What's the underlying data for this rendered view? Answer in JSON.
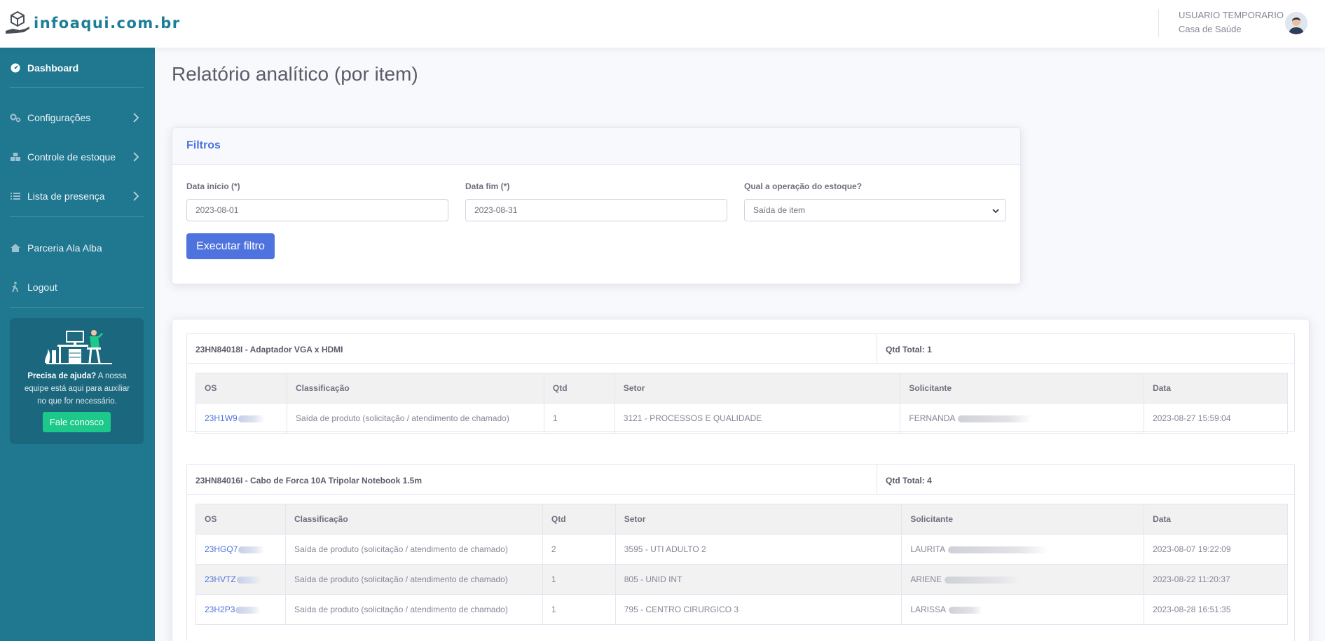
{
  "brand": {
    "name": "infoaqui.com.br"
  },
  "user": {
    "name": "USUARIO TEMPORARIO",
    "organization": "Casa de Saúde"
  },
  "sidebar": {
    "items": [
      {
        "label": "Dashboard",
        "icon": "tachometer-icon",
        "active": true
      },
      {
        "label": "Configurações",
        "icon": "cogs-icon",
        "has_submenu": true
      },
      {
        "label": "Controle de estoque",
        "icon": "boxes-icon",
        "has_submenu": true
      },
      {
        "label": "Lista de presença",
        "icon": "list-icon",
        "has_submenu": true
      },
      {
        "label": "Parceria Ala Alba",
        "icon": "house-icon"
      },
      {
        "label": "Logout",
        "icon": "walking-icon"
      }
    ],
    "help": {
      "title": "Precisa de ajuda?",
      "text": "A nossa equipe está aqui para auxiliar no que for necessário.",
      "button": "Fale conosco"
    }
  },
  "page": {
    "title": "Relatório analítico (por item)"
  },
  "filters": {
    "title": "Filtros",
    "start": {
      "label": "Data início (*)",
      "value": "2023-08-01"
    },
    "end": {
      "label": "Data fim (*)",
      "value": "2023-08-31"
    },
    "operation": {
      "label": "Qual a operação do estoque?",
      "value": "Saída de item"
    },
    "submit": "Executar filtro"
  },
  "report": {
    "columns": [
      "OS",
      "Classificação",
      "Qtd",
      "Setor",
      "Solicitante",
      "Data"
    ],
    "items": [
      {
        "title": "23HN84018I - Adaptador VGA x HDMI",
        "total": "Qtd Total: 1",
        "rows": [
          {
            "os": "23H1W9",
            "classificacao": "Saída de produto (solicitação / atendimento de chamado)",
            "qtd": "1",
            "setor": "3121 - PROCESSOS E QUALIDADE",
            "solicitante": "FERNANDA",
            "data": "2023-08-27 15:59:04"
          }
        ]
      },
      {
        "title": "23HN84016I - Cabo de Forca 10A Tripolar Notebook 1.5m",
        "total": "Qtd Total: 4",
        "rows": [
          {
            "os": "23HGQ7",
            "classificacao": "Saída de produto (solicitação / atendimento de chamado)",
            "qtd": "2",
            "setor": "3595 - UTI ADULTO 2",
            "solicitante": "LAURITA",
            "data": "2023-08-07 19:22:09"
          },
          {
            "os": "23HVTZ",
            "classificacao": "Saída de produto (solicitação / atendimento de chamado)",
            "qtd": "1",
            "setor": "805 - UNID INT",
            "solicitante": "ARIENE",
            "data": "2023-08-22 11:20:37"
          },
          {
            "os": "23H2P3",
            "classificacao": "Saída de produto (solicitação / atendimento de chamado)",
            "qtd": "1",
            "setor": "795 - CENTRO CIRURGICO 3",
            "solicitante": "LARISSA",
            "data": "2023-08-28 16:51:35"
          }
        ]
      }
    ]
  },
  "colors": {
    "sidebar": "#1f7790",
    "primary": "#4e73df",
    "success": "#1cc88a",
    "brand_text": "#1d7d98"
  }
}
